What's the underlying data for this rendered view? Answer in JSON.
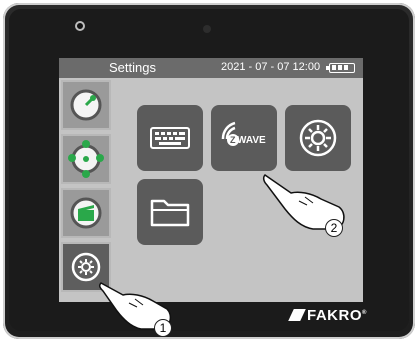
{
  "status_bar": {
    "title": "Settings",
    "datetime": "2021 - 07 - 07  12:00",
    "battery_level": 1.0
  },
  "sidebar": {
    "items": [
      {
        "icon": "valve-gauge-icon",
        "active": false
      },
      {
        "icon": "multi-device-icon",
        "active": false
      },
      {
        "icon": "scene-clapper-icon",
        "active": false
      },
      {
        "icon": "settings-gear-icon",
        "active": true
      }
    ]
  },
  "tiles": [
    {
      "icon": "keyboard-icon"
    },
    {
      "icon": "zwave-icon",
      "label": "WAVE"
    },
    {
      "icon": "settings-gear-icon"
    },
    {
      "icon": "folder-icon"
    }
  ],
  "callouts": [
    "1",
    "2"
  ],
  "brand": {
    "name": "FAKRO",
    "mark": "®"
  },
  "colors": {
    "accent_green": "#2aa84a",
    "tile": "#5b5b5b",
    "status": "#6b6b6b"
  }
}
